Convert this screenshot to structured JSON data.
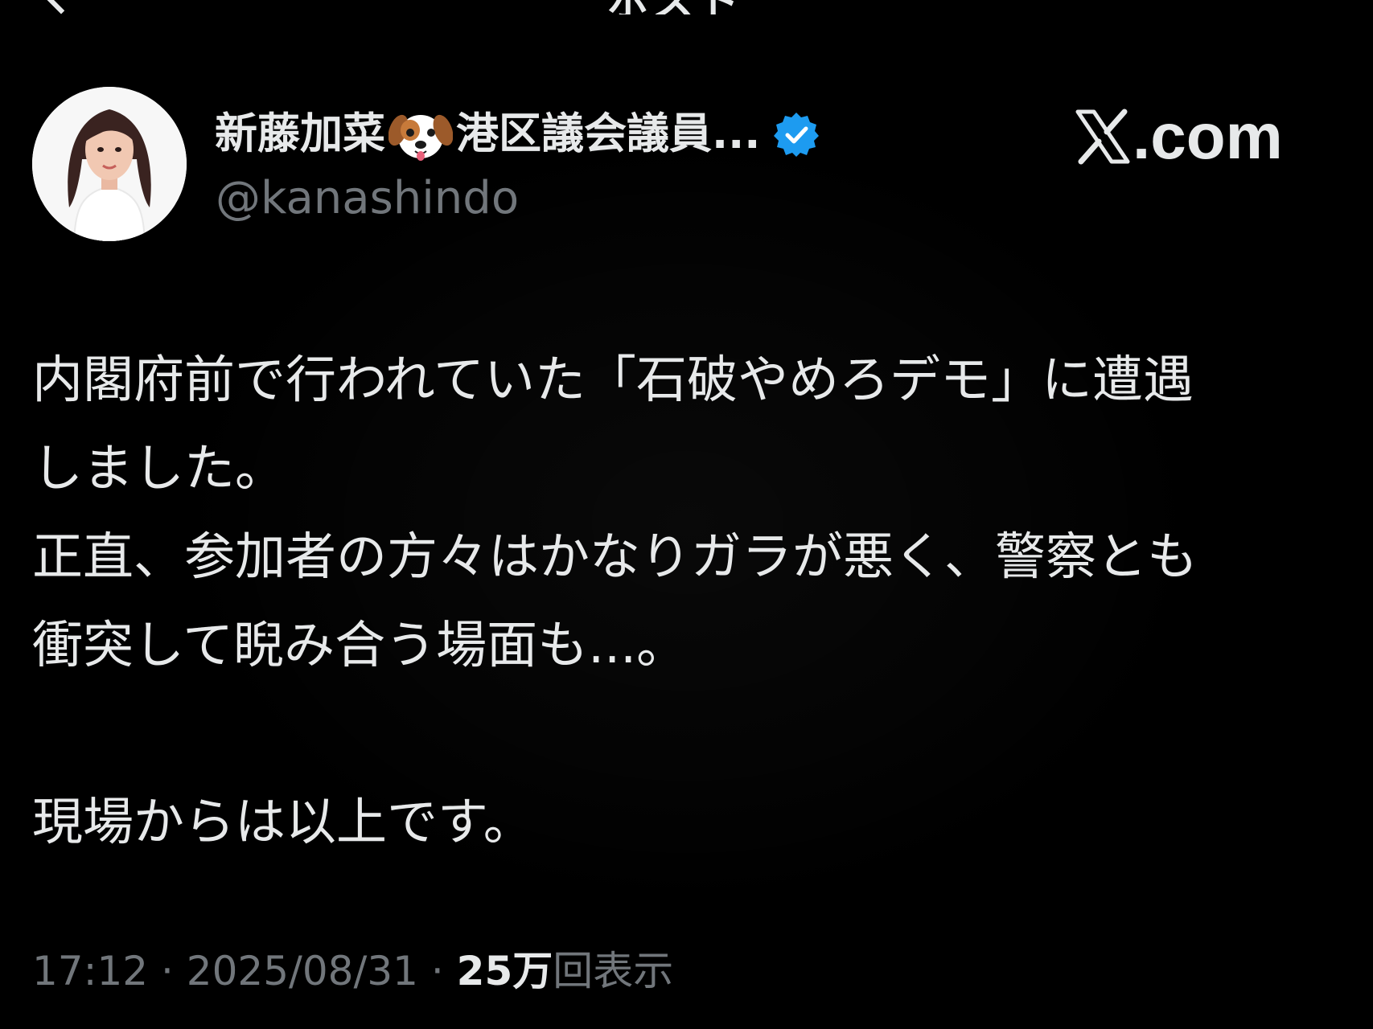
{
  "header": {
    "title": "ポスト",
    "back_icon": "chevron-left-icon"
  },
  "author": {
    "display_name": "新藤加菜",
    "emoji": "dog-face-icon",
    "name_suffix": "港区議会議員...",
    "verified_icon": "verified-badge-icon",
    "verified_color": "#1d9bf0",
    "handle": "@kanashindo"
  },
  "watermark": {
    "icon": "x-logo-icon",
    "text": ".com"
  },
  "tweet": {
    "lines": [
      "内閣府前で行われていた「石破やめろデモ」に遭遇",
      "しました。",
      "正直、参加者の方々はかなりガラが悪く、警察とも",
      "衝突して睨み合う場面も...。",
      "",
      "現場からは以上です。"
    ]
  },
  "meta": {
    "time": "17:12",
    "separator1": " · ",
    "date": "2025/08/31",
    "separator2": " · ",
    "views_count": "25万",
    "views_label": "回表示"
  },
  "colors": {
    "background": "#000000",
    "text": "#e7e9ea",
    "secondary": "#71767b",
    "accent": "#1d9bf0"
  }
}
